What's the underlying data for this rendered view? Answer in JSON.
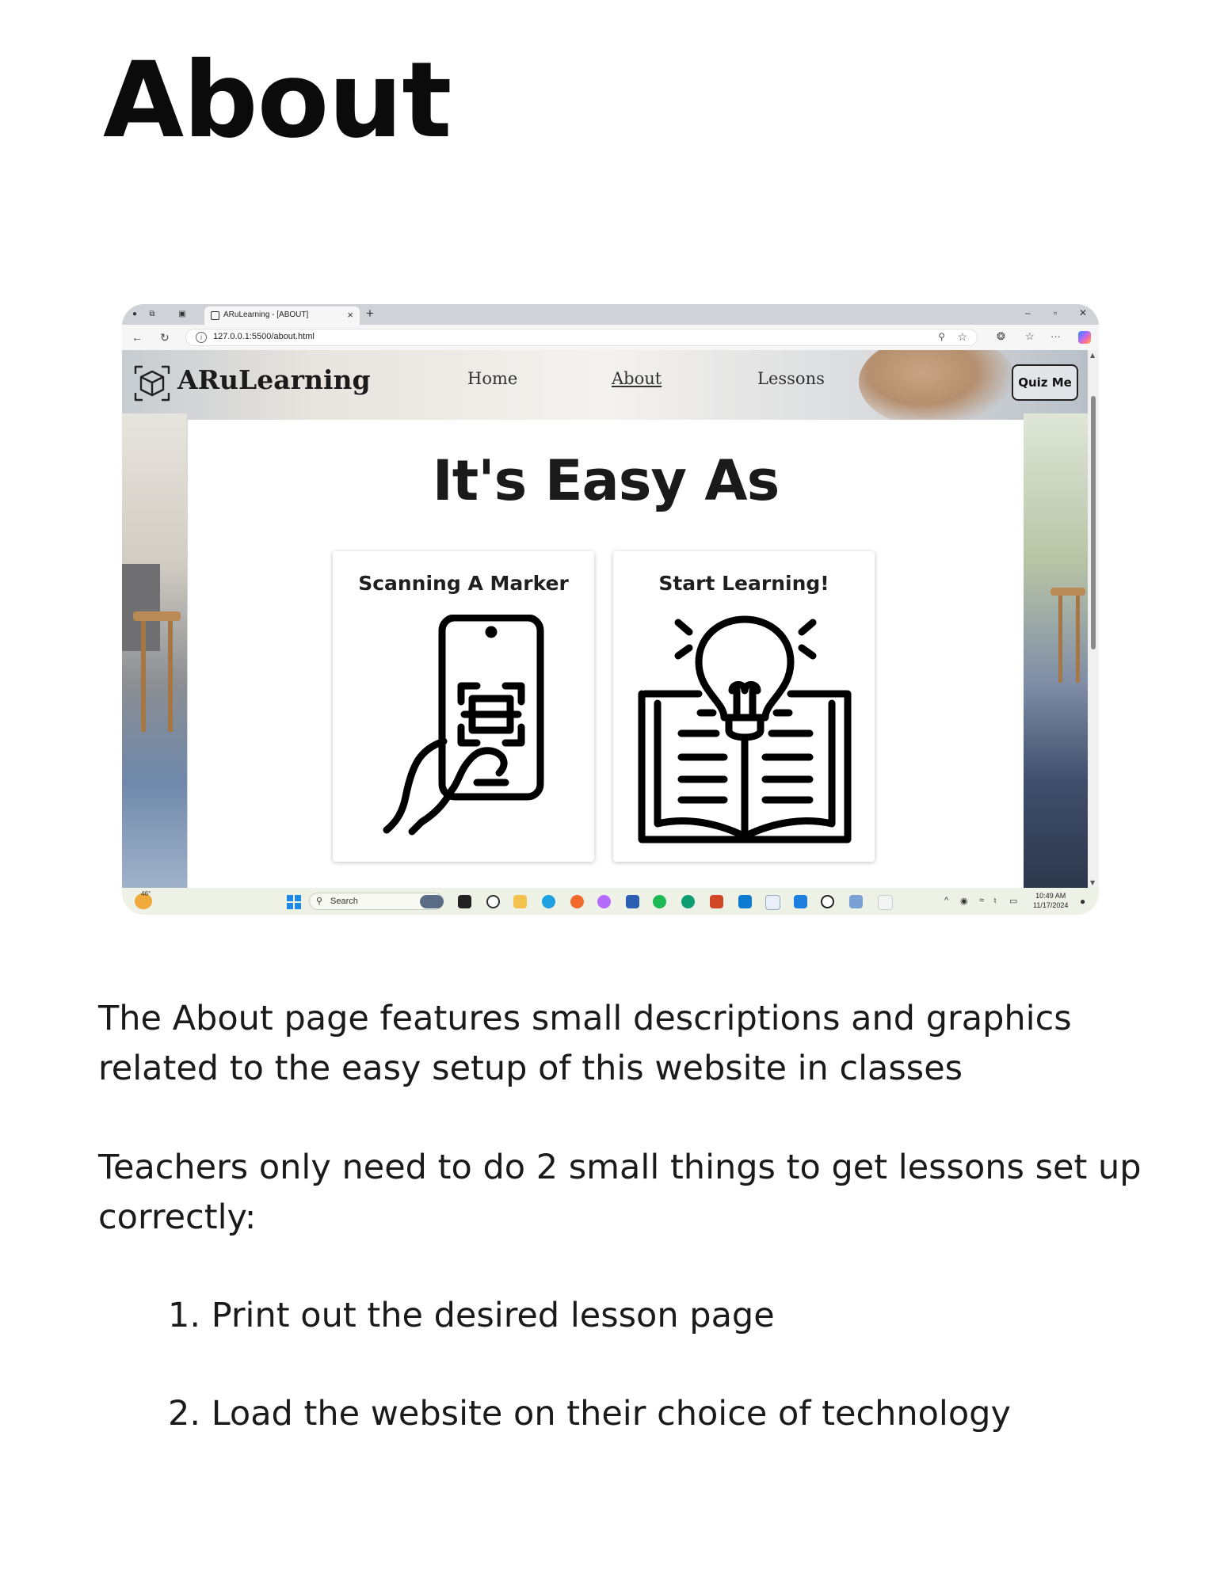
{
  "page": {
    "title": "About",
    "paragraphs": [
      "The About page features small descriptions and graphics related to the easy setup of this website in classes",
      "Teachers only need to do 2 small things to get lessons set up correctly:"
    ],
    "steps": [
      "1. Print out the desired lesson page",
      "2. Load the website on their choice of technology"
    ]
  },
  "browser": {
    "tab_title": "ARuLearning - [ABOUT]",
    "url": "127.0.0.1:5500/about.html"
  },
  "site": {
    "logo_text": "ARuLearning",
    "nav": [
      {
        "label": "Home",
        "active": false
      },
      {
        "label": "About",
        "active": true
      },
      {
        "label": "Lessons",
        "active": false
      }
    ],
    "quiz_button": "Quiz Me",
    "heading": "It's Easy As",
    "cards": [
      {
        "title": "Scanning A Marker",
        "icon": "phone-scan-qr-icon"
      },
      {
        "title": "Start Learning!",
        "icon": "book-lightbulb-icon"
      }
    ]
  },
  "taskbar": {
    "weather_temp": "46°",
    "search_label": "Search",
    "time": "10:49 AM",
    "date": "11/17/2024"
  },
  "colors": {
    "text": "#1a1a1a",
    "card_bg": "#ffffff",
    "taskbar_bg": "#eef1e6",
    "tabbar_bg": "#cfd3d8"
  }
}
